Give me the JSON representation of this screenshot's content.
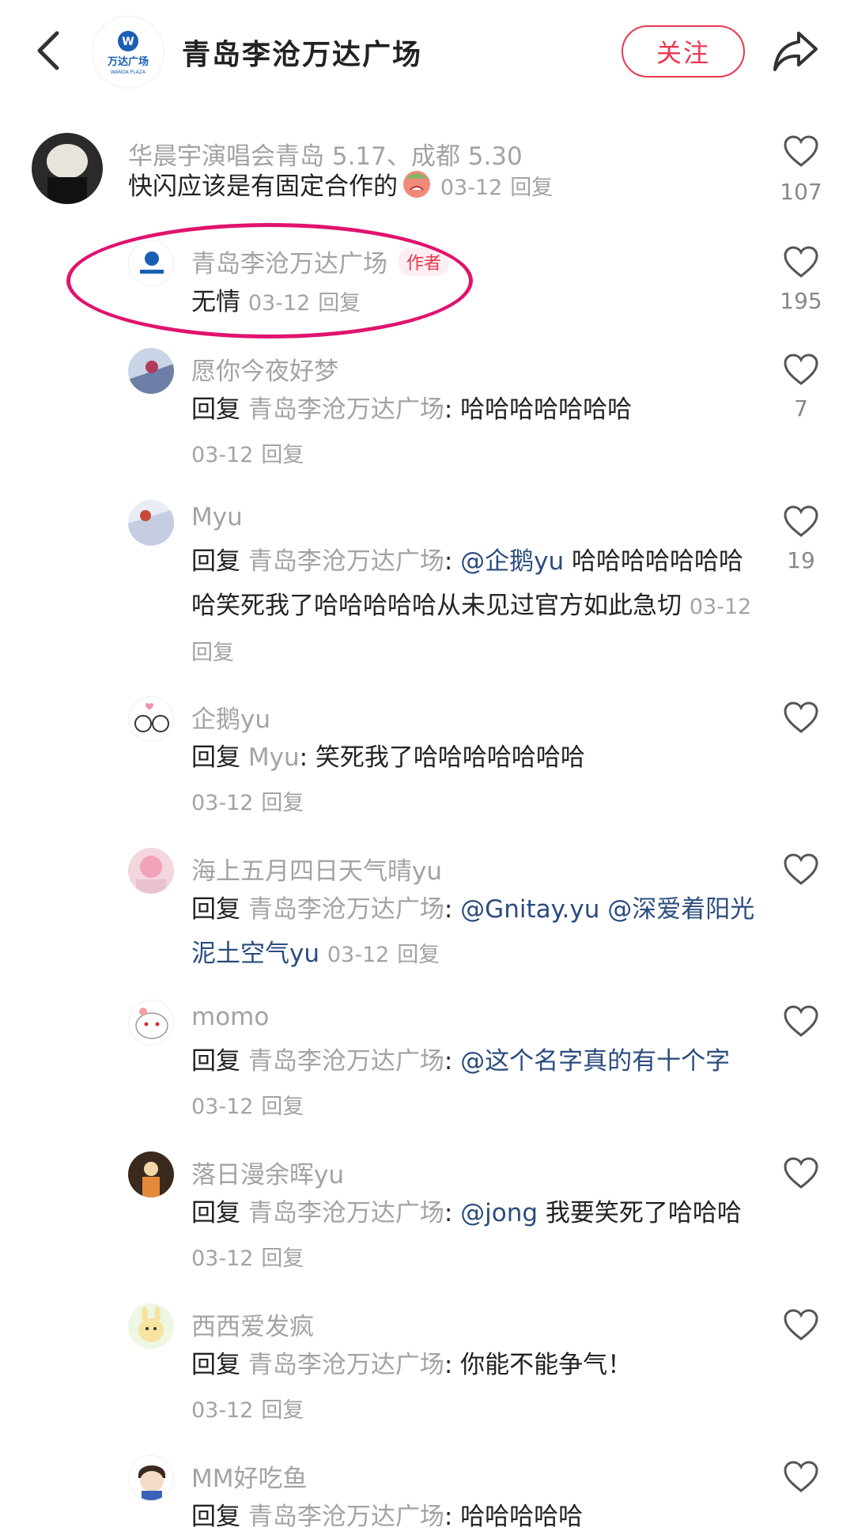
{
  "header": {
    "title": "青岛李沧万达广场",
    "follow_label": "关注",
    "logo_text_cn": "万达广场",
    "logo_text_en": "WANDA PLAZA"
  },
  "comments": [
    {
      "name": "华晨宇演唱会青岛 5.17、成都 5.30",
      "text": "快闪应该是有固定合作的",
      "date": "03-12",
      "reply_label": "回复",
      "likes": "107"
    },
    {
      "name": "青岛李沧万达广场",
      "tag": "作者",
      "text": "无情",
      "date": "03-12",
      "reply_label": "回复",
      "likes": "195"
    },
    {
      "name": "愿你今夜好梦",
      "reply_prefix": "回复",
      "reply_to": "青岛李沧万达广场",
      "text": ": 哈哈哈哈哈哈哈",
      "date": "03-12",
      "reply_label": "回复",
      "likes": "7"
    },
    {
      "name": "Myu",
      "reply_prefix": "回复",
      "reply_to": "青岛李沧万达广场",
      "colon": ": ",
      "mention": "@企鹅yu",
      "text": " 哈哈哈哈哈哈哈哈笑死我了哈哈哈哈哈从未见过官方如此急切",
      "date": "03-12",
      "reply_label": "回复",
      "likes": "19"
    },
    {
      "name": "企鹅yu",
      "reply_prefix": "回复",
      "reply_to": "Myu",
      "text": ": 笑死我了哈哈哈哈哈哈哈",
      "date": "03-12",
      "reply_label": "回复"
    },
    {
      "name": "海上五月四日天气晴yu",
      "reply_prefix": "回复",
      "reply_to": "青岛李沧万达广场",
      "colon": ": ",
      "mention": "@Gnitay.yu @深爱着阳光泥土空气yu",
      "date": "03-12",
      "reply_label": "回复"
    },
    {
      "name": "momo",
      "reply_prefix": "回复",
      "reply_to": "青岛李沧万达广场",
      "colon": ": ",
      "mention": "@这个名字真的有十个字",
      "date": "03-12",
      "reply_label": "回复"
    },
    {
      "name": "落日漫余晖yu",
      "reply_prefix": "回复",
      "reply_to": "青岛李沧万达广场",
      "colon": ": ",
      "mention": "@jong",
      "text": " 我要笑死了哈哈哈",
      "date": "03-12",
      "reply_label": "回复"
    },
    {
      "name": "西西爱发疯",
      "reply_prefix": "回复",
      "reply_to": "青岛李沧万达广场",
      "text": ": 你能不能争气！",
      "date": "03-12",
      "reply_label": "回复"
    },
    {
      "name": "MM好吃鱼",
      "reply_prefix": "回复",
      "reply_to": "青岛李沧万达广场",
      "text": ": 哈哈哈哈哈"
    }
  ],
  "colors": {
    "accent": "#e8384f",
    "mention": "#2b4c7e",
    "highlight": "#e0136e",
    "muted": "#a3a3a3"
  }
}
